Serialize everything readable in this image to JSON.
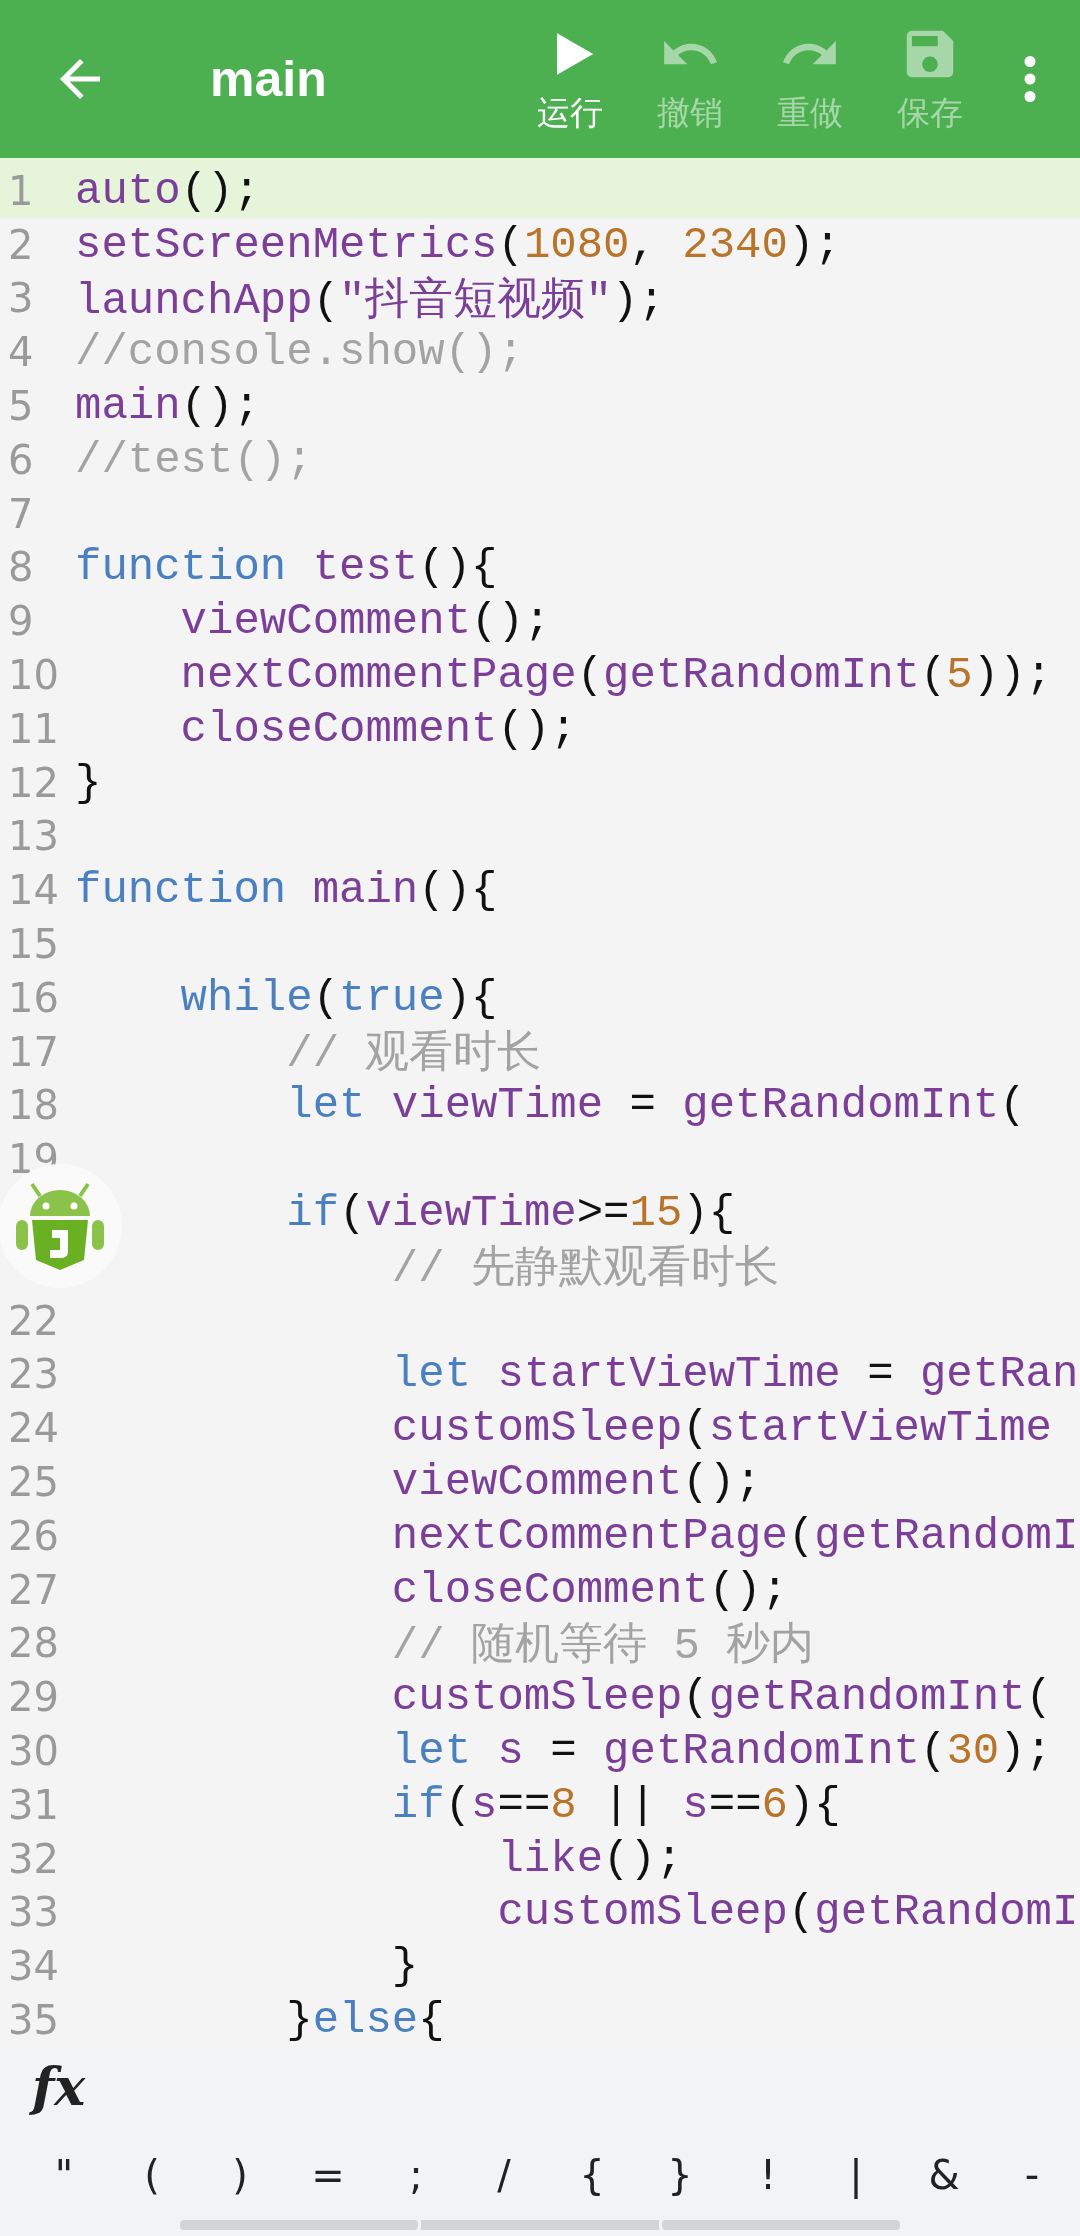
{
  "toolbar": {
    "title": "main",
    "actions": [
      {
        "kind": "run",
        "label": "运行",
        "disabled": false
      },
      {
        "kind": "undo",
        "label": "撤销",
        "disabled": true
      },
      {
        "kind": "redo",
        "label": "重做",
        "disabled": true
      },
      {
        "kind": "save",
        "label": "保存",
        "disabled": true
      }
    ]
  },
  "editor": {
    "lines": [
      {
        "number": "1",
        "selected": true,
        "tokens": [
          {
            "kind": "fn",
            "text": "auto"
          },
          {
            "kind": "p",
            "text": "();"
          }
        ]
      },
      {
        "number": "2",
        "selected": false,
        "tokens": [
          {
            "kind": "fn",
            "text": "setScreenMetrics"
          },
          {
            "kind": "p",
            "text": "("
          },
          {
            "kind": "num",
            "text": "1080"
          },
          {
            "kind": "p",
            "text": ", "
          },
          {
            "kind": "num",
            "text": "2340"
          },
          {
            "kind": "p",
            "text": ");"
          }
        ]
      },
      {
        "number": "3",
        "selected": false,
        "tokens": [
          {
            "kind": "fn",
            "text": "launchApp"
          },
          {
            "kind": "p",
            "text": "("
          },
          {
            "kind": "str",
            "text": "\"抖音短视频\""
          },
          {
            "kind": "p",
            "text": ");"
          }
        ]
      },
      {
        "number": "4",
        "selected": false,
        "tokens": [
          {
            "kind": "comment",
            "text": "//console.show();"
          }
        ]
      },
      {
        "number": "5",
        "selected": false,
        "tokens": [
          {
            "kind": "fn",
            "text": "main"
          },
          {
            "kind": "p",
            "text": "();"
          }
        ]
      },
      {
        "number": "6",
        "selected": false,
        "tokens": [
          {
            "kind": "comment",
            "text": "//test();"
          }
        ]
      },
      {
        "number": "7",
        "selected": false
      },
      {
        "number": "8",
        "selected": false,
        "tokens": [
          {
            "kind": "kw",
            "text": "function"
          },
          {
            "kind": "fn",
            "text": " test"
          },
          {
            "kind": "p",
            "text": "(){"
          }
        ]
      },
      {
        "number": "9",
        "selected": false,
        "tokens": [
          {
            "kind": "fn",
            "text": "    viewComment"
          },
          {
            "kind": "p",
            "text": "();"
          }
        ]
      },
      {
        "number": "10",
        "selected": false,
        "tokens": [
          {
            "kind": "fn",
            "text": "    nextCommentPage"
          },
          {
            "kind": "p",
            "text": "("
          },
          {
            "kind": "fn",
            "text": "getRandomInt"
          },
          {
            "kind": "p",
            "text": "("
          },
          {
            "kind": "num",
            "text": "5"
          },
          {
            "kind": "p",
            "text": "));"
          }
        ]
      },
      {
        "number": "11",
        "selected": false,
        "tokens": [
          {
            "kind": "fn",
            "text": "    closeComment"
          },
          {
            "kind": "p",
            "text": "();"
          }
        ]
      },
      {
        "number": "12",
        "selected": false,
        "tokens": [
          {
            "kind": "p",
            "text": "}"
          }
        ]
      },
      {
        "number": "13",
        "selected": false
      },
      {
        "number": "14",
        "selected": false,
        "tokens": [
          {
            "kind": "kw",
            "text": "function"
          },
          {
            "kind": "fn",
            "text": " main"
          },
          {
            "kind": "p",
            "text": "(){"
          }
        ]
      },
      {
        "number": "15",
        "selected": false
      },
      {
        "number": "16",
        "selected": false,
        "tokens": [
          {
            "kind": "kw",
            "text": "    while"
          },
          {
            "kind": "p",
            "text": "("
          },
          {
            "kind": "kw",
            "text": "true"
          },
          {
            "kind": "p",
            "text": "){"
          }
        ]
      },
      {
        "number": "17",
        "selected": false,
        "tokens": [
          {
            "kind": "comment",
            "text": "        // 观看时长"
          }
        ]
      },
      {
        "number": "18",
        "selected": false,
        "tokens": [
          {
            "kind": "kw",
            "text": "        let"
          },
          {
            "kind": "fn",
            "text": " viewTime"
          },
          {
            "kind": "p",
            "text": " = "
          },
          {
            "kind": "fn",
            "text": "getRandomInt"
          },
          {
            "kind": "p",
            "text": "("
          }
        ]
      },
      {
        "number": "19",
        "selected": false
      },
      {
        "selected": false,
        "tokens": [
          {
            "kind": "kw",
            "text": "        if"
          },
          {
            "kind": "p",
            "text": "("
          },
          {
            "kind": "fn",
            "text": "viewTime"
          },
          {
            "kind": "p",
            "text": ">="
          },
          {
            "kind": "num",
            "text": "15"
          },
          {
            "kind": "p",
            "text": "){"
          }
        ]
      },
      {
        "selected": false,
        "tokens": [
          {
            "kind": "comment",
            "text": "            // 先静默观看时长"
          }
        ]
      },
      {
        "number": "22",
        "selected": false
      },
      {
        "number": "23",
        "selected": false,
        "tokens": [
          {
            "kind": "kw",
            "text": "            let"
          },
          {
            "kind": "fn",
            "text": " startViewTime"
          },
          {
            "kind": "p",
            "text": " = "
          },
          {
            "kind": "fn",
            "text": "getRan"
          }
        ]
      },
      {
        "number": "24",
        "selected": false,
        "tokens": [
          {
            "kind": "fn",
            "text": "            customSleep"
          },
          {
            "kind": "p",
            "text": "("
          },
          {
            "kind": "fn",
            "text": "startViewTime"
          }
        ]
      },
      {
        "number": "25",
        "selected": false,
        "tokens": [
          {
            "kind": "fn",
            "text": "            viewComment"
          },
          {
            "kind": "p",
            "text": "();"
          }
        ]
      },
      {
        "number": "26",
        "selected": false,
        "tokens": [
          {
            "kind": "fn",
            "text": "            nextCommentPage"
          },
          {
            "kind": "p",
            "text": "("
          },
          {
            "kind": "fn",
            "text": "getRandomI"
          }
        ]
      },
      {
        "number": "27",
        "selected": false,
        "tokens": [
          {
            "kind": "fn",
            "text": "            closeComment"
          },
          {
            "kind": "p",
            "text": "();"
          }
        ]
      },
      {
        "number": "28",
        "selected": false,
        "tokens": [
          {
            "kind": "comment",
            "text": "            // 随机等待 5 秒内"
          }
        ]
      },
      {
        "number": "29",
        "selected": false,
        "tokens": [
          {
            "kind": "fn",
            "text": "            customSleep"
          },
          {
            "kind": "p",
            "text": "("
          },
          {
            "kind": "fn",
            "text": "getRandomInt"
          },
          {
            "kind": "p",
            "text": "("
          }
        ]
      },
      {
        "number": "30",
        "selected": false,
        "tokens": [
          {
            "kind": "kw",
            "text": "            let"
          },
          {
            "kind": "fn",
            "text": " s"
          },
          {
            "kind": "p",
            "text": " = "
          },
          {
            "kind": "fn",
            "text": "getRandomInt"
          },
          {
            "kind": "p",
            "text": "("
          },
          {
            "kind": "num",
            "text": "30"
          },
          {
            "kind": "p",
            "text": ");"
          }
        ]
      },
      {
        "number": "31",
        "selected": false,
        "tokens": [
          {
            "kind": "kw",
            "text": "            if"
          },
          {
            "kind": "p",
            "text": "("
          },
          {
            "kind": "fn",
            "text": "s"
          },
          {
            "kind": "p",
            "text": "=="
          },
          {
            "kind": "num",
            "text": "8"
          },
          {
            "kind": "p",
            "text": " || "
          },
          {
            "kind": "fn",
            "text": "s"
          },
          {
            "kind": "p",
            "text": "=="
          },
          {
            "kind": "num",
            "text": "6"
          },
          {
            "kind": "p",
            "text": "){"
          }
        ]
      },
      {
        "number": "32",
        "selected": false,
        "tokens": [
          {
            "kind": "fn",
            "text": "                like"
          },
          {
            "kind": "p",
            "text": "();"
          }
        ]
      },
      {
        "number": "33",
        "selected": false,
        "tokens": [
          {
            "kind": "fn",
            "text": "                customSleep"
          },
          {
            "kind": "p",
            "text": "("
          },
          {
            "kind": "fn",
            "text": "getRandomI"
          }
        ]
      },
      {
        "number": "34",
        "selected": false,
        "tokens": [
          {
            "kind": "p",
            "text": "            }"
          }
        ]
      },
      {
        "number": "35",
        "selected": false,
        "tokens": [
          {
            "kind": "p",
            "text": "        }"
          },
          {
            "kind": "kw",
            "text": "else"
          },
          {
            "kind": "p",
            "text": "{"
          }
        ]
      }
    ]
  },
  "keyboard_bar": {
    "function_button": "fx",
    "keys": [
      "\"",
      "(",
      ")",
      "=",
      ";",
      "/",
      "{",
      "}",
      "!",
      "|",
      "&",
      "-"
    ]
  }
}
